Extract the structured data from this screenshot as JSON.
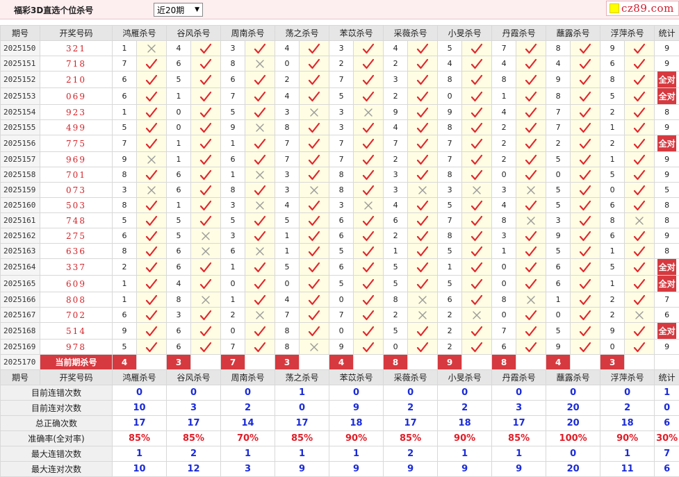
{
  "header": {
    "title": "福彩3D直选个位杀号",
    "period_select": "近20期",
    "logo_text": "cz89.com"
  },
  "columns": {
    "issue": "期号",
    "numbers": "开奖号码",
    "experts": [
      "鸿雁杀号",
      "谷风杀号",
      "周南杀号",
      "荡之杀号",
      "苯苡杀号",
      "采薇杀号",
      "小旻杀号",
      "丹霞杀号",
      "蘸露杀号",
      "浮萍杀号"
    ],
    "stats": "统计"
  },
  "full_label": "全对",
  "rows": [
    {
      "issue": "2025150",
      "numbers": "321",
      "picks": [
        [
          1,
          0
        ],
        [
          4,
          1
        ],
        [
          3,
          1
        ],
        [
          4,
          1
        ],
        [
          3,
          1
        ],
        [
          4,
          1
        ],
        [
          5,
          1
        ],
        [
          7,
          1
        ],
        [
          8,
          1
        ],
        [
          9,
          1
        ]
      ],
      "count": "9",
      "full": false
    },
    {
      "issue": "2025151",
      "numbers": "718",
      "picks": [
        [
          7,
          1
        ],
        [
          6,
          1
        ],
        [
          8,
          0
        ],
        [
          0,
          1
        ],
        [
          2,
          1
        ],
        [
          2,
          1
        ],
        [
          4,
          1
        ],
        [
          4,
          1
        ],
        [
          4,
          1
        ],
        [
          6,
          1
        ]
      ],
      "count": "9",
      "full": false
    },
    {
      "issue": "2025152",
      "numbers": "210",
      "picks": [
        [
          6,
          1
        ],
        [
          5,
          1
        ],
        [
          6,
          1
        ],
        [
          2,
          1
        ],
        [
          7,
          1
        ],
        [
          3,
          1
        ],
        [
          8,
          1
        ],
        [
          8,
          1
        ],
        [
          9,
          1
        ],
        [
          8,
          1
        ]
      ],
      "count": "全对",
      "full": true
    },
    {
      "issue": "2025153",
      "numbers": "069",
      "picks": [
        [
          6,
          1
        ],
        [
          1,
          1
        ],
        [
          7,
          1
        ],
        [
          4,
          1
        ],
        [
          5,
          1
        ],
        [
          2,
          1
        ],
        [
          0,
          1
        ],
        [
          1,
          1
        ],
        [
          8,
          1
        ],
        [
          5,
          1
        ]
      ],
      "count": "全对",
      "full": true
    },
    {
      "issue": "2025154",
      "numbers": "923",
      "picks": [
        [
          1,
          1
        ],
        [
          0,
          1
        ],
        [
          5,
          1
        ],
        [
          3,
          0
        ],
        [
          3,
          0
        ],
        [
          9,
          1
        ],
        [
          9,
          1
        ],
        [
          4,
          1
        ],
        [
          7,
          1
        ],
        [
          2,
          1
        ]
      ],
      "count": "8",
      "full": false
    },
    {
      "issue": "2025155",
      "numbers": "499",
      "picks": [
        [
          5,
          1
        ],
        [
          0,
          1
        ],
        [
          9,
          0
        ],
        [
          8,
          1
        ],
        [
          3,
          1
        ],
        [
          4,
          1
        ],
        [
          8,
          1
        ],
        [
          2,
          1
        ],
        [
          7,
          1
        ],
        [
          1,
          1
        ]
      ],
      "count": "9",
      "full": false
    },
    {
      "issue": "2025156",
      "numbers": "775",
      "picks": [
        [
          7,
          1
        ],
        [
          1,
          1
        ],
        [
          1,
          1
        ],
        [
          7,
          1
        ],
        [
          7,
          1
        ],
        [
          7,
          1
        ],
        [
          7,
          1
        ],
        [
          2,
          1
        ],
        [
          2,
          1
        ],
        [
          2,
          1
        ]
      ],
      "count": "全对",
      "full": true
    },
    {
      "issue": "2025157",
      "numbers": "969",
      "picks": [
        [
          9,
          0
        ],
        [
          1,
          1
        ],
        [
          6,
          1
        ],
        [
          7,
          1
        ],
        [
          7,
          1
        ],
        [
          2,
          1
        ],
        [
          7,
          1
        ],
        [
          2,
          1
        ],
        [
          5,
          1
        ],
        [
          1,
          1
        ]
      ],
      "count": "9",
      "full": false
    },
    {
      "issue": "2025158",
      "numbers": "701",
      "picks": [
        [
          8,
          1
        ],
        [
          6,
          1
        ],
        [
          1,
          0
        ],
        [
          3,
          1
        ],
        [
          8,
          1
        ],
        [
          3,
          1
        ],
        [
          8,
          1
        ],
        [
          0,
          1
        ],
        [
          0,
          1
        ],
        [
          5,
          1
        ]
      ],
      "count": "9",
      "full": false
    },
    {
      "issue": "2025159",
      "numbers": "073",
      "picks": [
        [
          3,
          0
        ],
        [
          6,
          1
        ],
        [
          8,
          1
        ],
        [
          3,
          0
        ],
        [
          8,
          1
        ],
        [
          3,
          0
        ],
        [
          3,
          0
        ],
        [
          3,
          0
        ],
        [
          5,
          1
        ],
        [
          0,
          1
        ]
      ],
      "count": "5",
      "full": false
    },
    {
      "issue": "2025160",
      "numbers": "503",
      "picks": [
        [
          8,
          1
        ],
        [
          1,
          1
        ],
        [
          3,
          0
        ],
        [
          4,
          1
        ],
        [
          3,
          0
        ],
        [
          4,
          1
        ],
        [
          5,
          1
        ],
        [
          4,
          1
        ],
        [
          5,
          1
        ],
        [
          6,
          1
        ]
      ],
      "count": "8",
      "full": false
    },
    {
      "issue": "2025161",
      "numbers": "748",
      "picks": [
        [
          5,
          1
        ],
        [
          5,
          1
        ],
        [
          5,
          1
        ],
        [
          5,
          1
        ],
        [
          6,
          1
        ],
        [
          6,
          1
        ],
        [
          7,
          1
        ],
        [
          8,
          0
        ],
        [
          3,
          1
        ],
        [
          8,
          0
        ]
      ],
      "count": "8",
      "full": false
    },
    {
      "issue": "2025162",
      "numbers": "275",
      "picks": [
        [
          6,
          1
        ],
        [
          5,
          0
        ],
        [
          3,
          1
        ],
        [
          1,
          1
        ],
        [
          6,
          1
        ],
        [
          2,
          1
        ],
        [
          8,
          1
        ],
        [
          3,
          1
        ],
        [
          9,
          1
        ],
        [
          6,
          1
        ]
      ],
      "count": "9",
      "full": false
    },
    {
      "issue": "2025163",
      "numbers": "636",
      "picks": [
        [
          8,
          1
        ],
        [
          6,
          0
        ],
        [
          6,
          0
        ],
        [
          1,
          1
        ],
        [
          5,
          1
        ],
        [
          1,
          1
        ],
        [
          5,
          1
        ],
        [
          1,
          1
        ],
        [
          5,
          1
        ],
        [
          1,
          1
        ]
      ],
      "count": "8",
      "full": false
    },
    {
      "issue": "2025164",
      "numbers": "337",
      "picks": [
        [
          2,
          1
        ],
        [
          6,
          1
        ],
        [
          1,
          1
        ],
        [
          5,
          1
        ],
        [
          6,
          1
        ],
        [
          5,
          1
        ],
        [
          1,
          1
        ],
        [
          0,
          1
        ],
        [
          6,
          1
        ],
        [
          5,
          1
        ]
      ],
      "count": "全对",
      "full": true
    },
    {
      "issue": "2025165",
      "numbers": "609",
      "picks": [
        [
          1,
          1
        ],
        [
          4,
          1
        ],
        [
          0,
          1
        ],
        [
          0,
          1
        ],
        [
          5,
          1
        ],
        [
          5,
          1
        ],
        [
          5,
          1
        ],
        [
          0,
          1
        ],
        [
          6,
          1
        ],
        [
          1,
          1
        ]
      ],
      "count": "全对",
      "full": true
    },
    {
      "issue": "2025166",
      "numbers": "808",
      "picks": [
        [
          1,
          1
        ],
        [
          8,
          0
        ],
        [
          1,
          1
        ],
        [
          4,
          1
        ],
        [
          0,
          1
        ],
        [
          8,
          0
        ],
        [
          6,
          1
        ],
        [
          8,
          0
        ],
        [
          1,
          1
        ],
        [
          2,
          1
        ]
      ],
      "count": "7",
      "full": false
    },
    {
      "issue": "2025167",
      "numbers": "702",
      "picks": [
        [
          6,
          1
        ],
        [
          3,
          1
        ],
        [
          2,
          0
        ],
        [
          7,
          1
        ],
        [
          7,
          1
        ],
        [
          2,
          0
        ],
        [
          2,
          0
        ],
        [
          0,
          1
        ],
        [
          0,
          1
        ],
        [
          2,
          0
        ]
      ],
      "count": "6",
      "full": false
    },
    {
      "issue": "2025168",
      "numbers": "514",
      "picks": [
        [
          9,
          1
        ],
        [
          6,
          1
        ],
        [
          0,
          1
        ],
        [
          8,
          1
        ],
        [
          0,
          1
        ],
        [
          5,
          1
        ],
        [
          2,
          1
        ],
        [
          7,
          1
        ],
        [
          5,
          1
        ],
        [
          9,
          1
        ]
      ],
      "count": "全对",
      "full": true
    },
    {
      "issue": "2025169",
      "numbers": "978",
      "picks": [
        [
          5,
          1
        ],
        [
          6,
          1
        ],
        [
          7,
          1
        ],
        [
          8,
          0
        ],
        [
          9,
          1
        ],
        [
          0,
          1
        ],
        [
          2,
          1
        ],
        [
          6,
          1
        ],
        [
          9,
          1
        ],
        [
          0,
          1
        ]
      ],
      "count": "9",
      "full": false
    }
  ],
  "current": {
    "issue": "2025170",
    "label": "当前期杀号",
    "picks": [
      "4",
      "3",
      "7",
      "3",
      "4",
      "8",
      "9",
      "8",
      "4",
      "3"
    ]
  },
  "summary": [
    {
      "label": "目前连错次数",
      "values": [
        "0",
        "0",
        "0",
        "1",
        "0",
        "0",
        "0",
        "0",
        "0",
        "0"
      ],
      "total": "1",
      "type": "num"
    },
    {
      "label": "目前连对次数",
      "values": [
        "10",
        "3",
        "2",
        "0",
        "9",
        "2",
        "2",
        "3",
        "20",
        "2"
      ],
      "total": "0",
      "type": "num"
    },
    {
      "label": "总正确次数",
      "values": [
        "17",
        "17",
        "14",
        "17",
        "18",
        "17",
        "18",
        "17",
        "20",
        "18"
      ],
      "total": "6",
      "type": "num"
    },
    {
      "label": "准确率(全对率)",
      "values": [
        "85%",
        "85%",
        "70%",
        "85%",
        "90%",
        "85%",
        "90%",
        "85%",
        "100%",
        "90%"
      ],
      "total": "30%",
      "type": "pct"
    },
    {
      "label": "最大连错次数",
      "values": [
        "1",
        "2",
        "1",
        "1",
        "1",
        "2",
        "1",
        "1",
        "0",
        "1"
      ],
      "total": "7",
      "type": "num"
    },
    {
      "label": "最大连对次数",
      "values": [
        "10",
        "12",
        "3",
        "9",
        "9",
        "9",
        "9",
        "9",
        "20",
        "11"
      ],
      "total": "6",
      "type": "num"
    }
  ]
}
